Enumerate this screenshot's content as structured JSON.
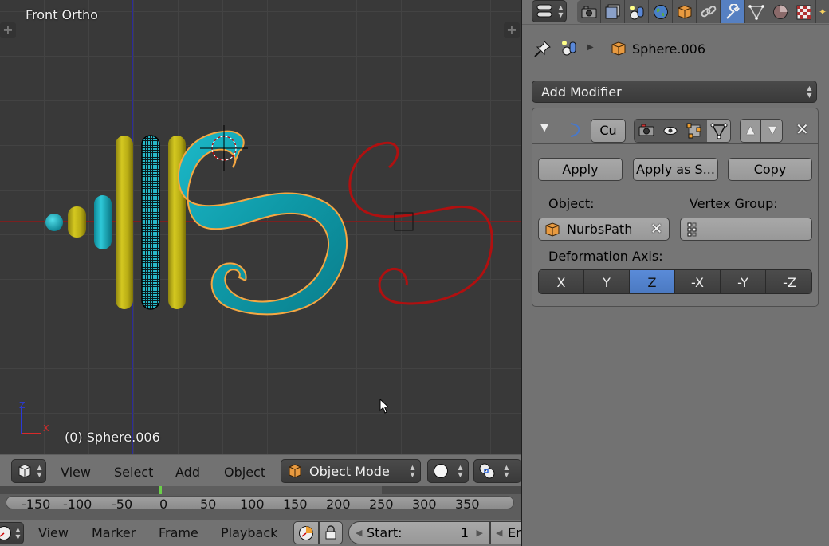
{
  "viewport": {
    "title": "Front Ortho",
    "active_object_label": "(0) Sphere.006",
    "axis_labels": {
      "z": "Z",
      "x": "X"
    },
    "colors": {
      "selected_outline": "#f5a742",
      "cyan": "#1ab0c0",
      "yellow": "#c8bc18",
      "curve": "#b01010"
    }
  },
  "viewport_header": {
    "editor_type_icon": "cube-view-icon",
    "menus": [
      "View",
      "Select",
      "Add",
      "Object"
    ],
    "mode": "Object Mode",
    "shading_icon": "solid-sphere-icon",
    "pivot_icon": "pivot-icon"
  },
  "timeline": {
    "ticks": [
      "-150",
      "-100",
      "-50",
      "0",
      "50",
      "100",
      "150",
      "200",
      "250",
      "300",
      "350"
    ],
    "current_frame": 0
  },
  "timeline_header": {
    "menus": [
      "View",
      "Marker",
      "Frame",
      "Playback"
    ],
    "start_label": "Start:",
    "start_value": "1",
    "end_label_truncated": "En"
  },
  "properties": {
    "tabs": [
      "render",
      "render-layers",
      "scene",
      "world",
      "object",
      "constraints",
      "modifiers",
      "data",
      "material",
      "texture",
      "particles"
    ],
    "active_tab": "modifiers",
    "breadcrumb": {
      "object_name": "Sphere.006"
    },
    "add_modifier_label": "Add Modifier",
    "modifier": {
      "name": "Cu",
      "type_icon": "curve-modifier-icon",
      "apply_label": "Apply",
      "apply_as_shape_label": "Apply as S...",
      "copy_label": "Copy",
      "object_label": "Object:",
      "object_value": "NurbsPath",
      "vertex_group_label": "Vertex Group:",
      "vertex_group_value": "",
      "deformation_axis_label": "Deformation Axis:",
      "axes": [
        "X",
        "Y",
        "Z",
        "-X",
        "-Y",
        "-Z"
      ],
      "active_axis": "Z"
    }
  }
}
